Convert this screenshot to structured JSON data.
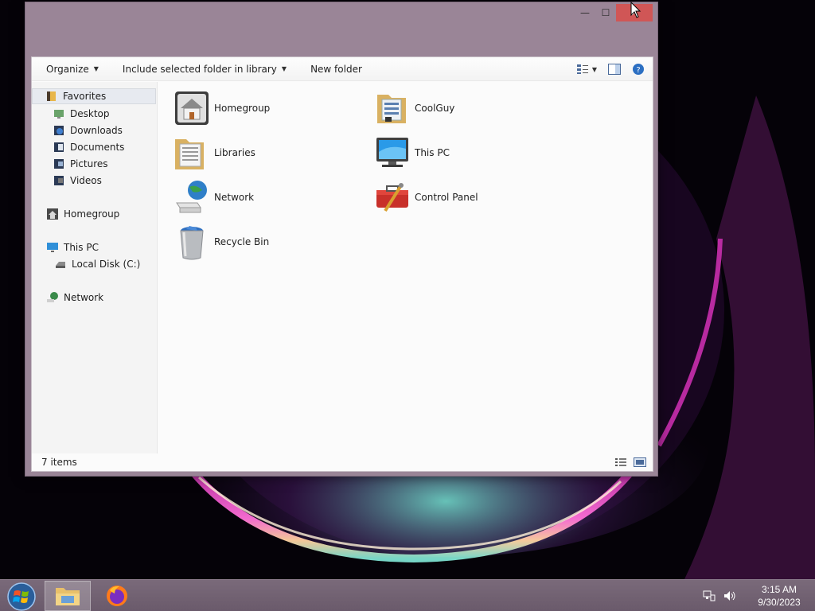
{
  "window": {
    "caption": {
      "minimize": "—",
      "maximize": "☐",
      "close": "✕"
    },
    "toolbar": {
      "organize": "Organize",
      "include_library": "Include selected folder in library",
      "new_folder": "New folder"
    },
    "nav": {
      "favorites": "Favorites",
      "desktop": "Desktop",
      "downloads": "Downloads",
      "documents": "Documents",
      "pictures": "Pictures",
      "videos": "Videos",
      "homegroup": "Homegroup",
      "this_pc": "This PC",
      "local_disk": "Local Disk (C:)",
      "network": "Network"
    },
    "items": {
      "homegroup": "Homegroup",
      "coolguy": "CoolGuy",
      "libraries": "Libraries",
      "this_pc": "This PC",
      "network": "Network",
      "control_panel": "Control Panel",
      "recycle_bin": "Recycle Bin"
    },
    "status": {
      "count": "7 items"
    }
  },
  "taskbar": {
    "clock": {
      "time": "3:15 AM",
      "date": "9/30/2023"
    }
  },
  "colors": {
    "window_frame": "#9a8597",
    "close_button": "#d05656",
    "taskbar": "#6f5f70"
  }
}
